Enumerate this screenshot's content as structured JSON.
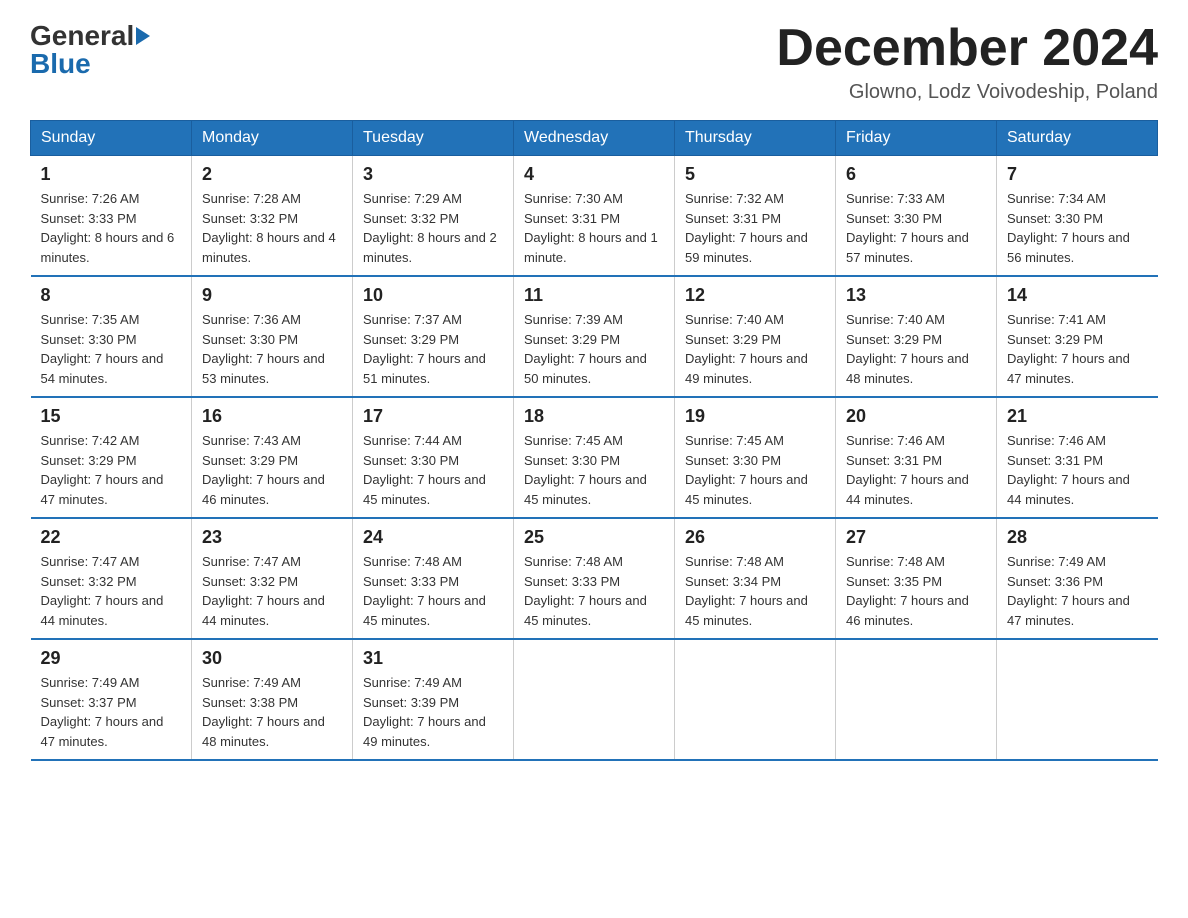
{
  "header": {
    "logo_general": "General",
    "logo_blue": "Blue",
    "month_title": "December 2024",
    "subtitle": "Glowno, Lodz Voivodeship, Poland"
  },
  "days_of_week": [
    "Sunday",
    "Monday",
    "Tuesday",
    "Wednesday",
    "Thursday",
    "Friday",
    "Saturday"
  ],
  "weeks": [
    [
      {
        "day": "1",
        "sunrise": "7:26 AM",
        "sunset": "3:33 PM",
        "daylight": "8 hours and 6 minutes."
      },
      {
        "day": "2",
        "sunrise": "7:28 AM",
        "sunset": "3:32 PM",
        "daylight": "8 hours and 4 minutes."
      },
      {
        "day": "3",
        "sunrise": "7:29 AM",
        "sunset": "3:32 PM",
        "daylight": "8 hours and 2 minutes."
      },
      {
        "day": "4",
        "sunrise": "7:30 AM",
        "sunset": "3:31 PM",
        "daylight": "8 hours and 1 minute."
      },
      {
        "day": "5",
        "sunrise": "7:32 AM",
        "sunset": "3:31 PM",
        "daylight": "7 hours and 59 minutes."
      },
      {
        "day": "6",
        "sunrise": "7:33 AM",
        "sunset": "3:30 PM",
        "daylight": "7 hours and 57 minutes."
      },
      {
        "day": "7",
        "sunrise": "7:34 AM",
        "sunset": "3:30 PM",
        "daylight": "7 hours and 56 minutes."
      }
    ],
    [
      {
        "day": "8",
        "sunrise": "7:35 AM",
        "sunset": "3:30 PM",
        "daylight": "7 hours and 54 minutes."
      },
      {
        "day": "9",
        "sunrise": "7:36 AM",
        "sunset": "3:30 PM",
        "daylight": "7 hours and 53 minutes."
      },
      {
        "day": "10",
        "sunrise": "7:37 AM",
        "sunset": "3:29 PM",
        "daylight": "7 hours and 51 minutes."
      },
      {
        "day": "11",
        "sunrise": "7:39 AM",
        "sunset": "3:29 PM",
        "daylight": "7 hours and 50 minutes."
      },
      {
        "day": "12",
        "sunrise": "7:40 AM",
        "sunset": "3:29 PM",
        "daylight": "7 hours and 49 minutes."
      },
      {
        "day": "13",
        "sunrise": "7:40 AM",
        "sunset": "3:29 PM",
        "daylight": "7 hours and 48 minutes."
      },
      {
        "day": "14",
        "sunrise": "7:41 AM",
        "sunset": "3:29 PM",
        "daylight": "7 hours and 47 minutes."
      }
    ],
    [
      {
        "day": "15",
        "sunrise": "7:42 AM",
        "sunset": "3:29 PM",
        "daylight": "7 hours and 47 minutes."
      },
      {
        "day": "16",
        "sunrise": "7:43 AM",
        "sunset": "3:29 PM",
        "daylight": "7 hours and 46 minutes."
      },
      {
        "day": "17",
        "sunrise": "7:44 AM",
        "sunset": "3:30 PM",
        "daylight": "7 hours and 45 minutes."
      },
      {
        "day": "18",
        "sunrise": "7:45 AM",
        "sunset": "3:30 PM",
        "daylight": "7 hours and 45 minutes."
      },
      {
        "day": "19",
        "sunrise": "7:45 AM",
        "sunset": "3:30 PM",
        "daylight": "7 hours and 45 minutes."
      },
      {
        "day": "20",
        "sunrise": "7:46 AM",
        "sunset": "3:31 PM",
        "daylight": "7 hours and 44 minutes."
      },
      {
        "day": "21",
        "sunrise": "7:46 AM",
        "sunset": "3:31 PM",
        "daylight": "7 hours and 44 minutes."
      }
    ],
    [
      {
        "day": "22",
        "sunrise": "7:47 AM",
        "sunset": "3:32 PM",
        "daylight": "7 hours and 44 minutes."
      },
      {
        "day": "23",
        "sunrise": "7:47 AM",
        "sunset": "3:32 PM",
        "daylight": "7 hours and 44 minutes."
      },
      {
        "day": "24",
        "sunrise": "7:48 AM",
        "sunset": "3:33 PM",
        "daylight": "7 hours and 45 minutes."
      },
      {
        "day": "25",
        "sunrise": "7:48 AM",
        "sunset": "3:33 PM",
        "daylight": "7 hours and 45 minutes."
      },
      {
        "day": "26",
        "sunrise": "7:48 AM",
        "sunset": "3:34 PM",
        "daylight": "7 hours and 45 minutes."
      },
      {
        "day": "27",
        "sunrise": "7:48 AM",
        "sunset": "3:35 PM",
        "daylight": "7 hours and 46 minutes."
      },
      {
        "day": "28",
        "sunrise": "7:49 AM",
        "sunset": "3:36 PM",
        "daylight": "7 hours and 47 minutes."
      }
    ],
    [
      {
        "day": "29",
        "sunrise": "7:49 AM",
        "sunset": "3:37 PM",
        "daylight": "7 hours and 47 minutes."
      },
      {
        "day": "30",
        "sunrise": "7:49 AM",
        "sunset": "3:38 PM",
        "daylight": "7 hours and 48 minutes."
      },
      {
        "day": "31",
        "sunrise": "7:49 AM",
        "sunset": "3:39 PM",
        "daylight": "7 hours and 49 minutes."
      },
      null,
      null,
      null,
      null
    ]
  ],
  "labels": {
    "sunrise": "Sunrise:",
    "sunset": "Sunset:",
    "daylight": "Daylight:"
  }
}
